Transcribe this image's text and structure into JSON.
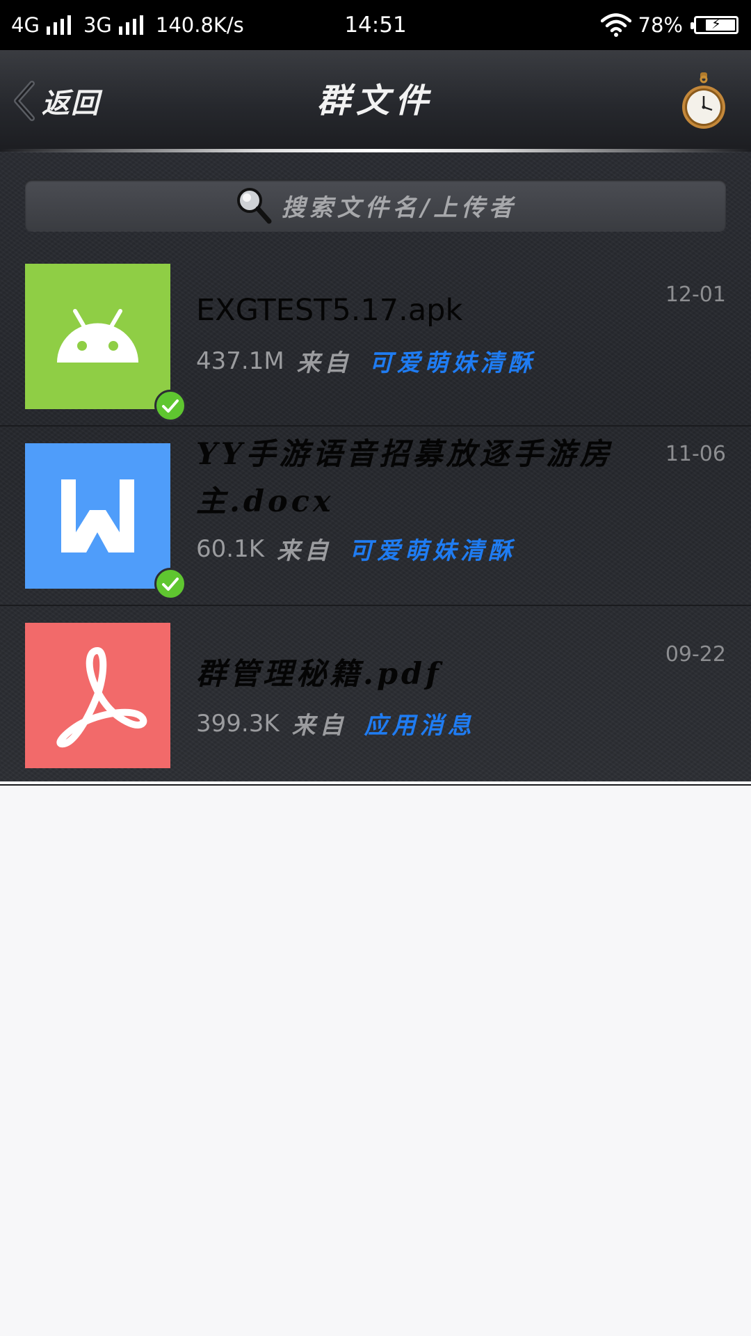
{
  "status_bar": {
    "net1": "4G",
    "net2": "3G",
    "speed": "140.8K/s",
    "time": "14:51",
    "battery": "78%",
    "battery_level": 0.78
  },
  "header": {
    "back_label": "返回",
    "title": "群文件"
  },
  "search": {
    "placeholder": "搜索文件名/上传者"
  },
  "files": [
    {
      "name": "EXGTEST5.17.apk",
      "date": "12-01",
      "size": "437.1M",
      "from_label": "来自",
      "sender": "可爱萌妹清酥",
      "icon": "android-icon",
      "icon_color": "#8fce45",
      "downloaded": true
    },
    {
      "name": "YY手游语音招募放逐手游房主.docx",
      "name_line1": "YY手游语音招募放逐手游房",
      "name_line2": "主.docx",
      "date": "11-06",
      "size": "60.1K",
      "from_label": "来自",
      "sender": "可爱萌妹清酥",
      "icon": "word-icon",
      "icon_color": "#4f9dfa",
      "downloaded": true
    },
    {
      "name": "群管理秘籍.pdf",
      "date": "09-22",
      "size": "399.3K",
      "from_label": "来自",
      "sender": "应用消息",
      "icon": "pdf-icon",
      "icon_color": "#f26a6a",
      "downloaded": false
    }
  ],
  "colors": {
    "accent_link": "#1f7cf2",
    "check_green": "#5fc630"
  }
}
